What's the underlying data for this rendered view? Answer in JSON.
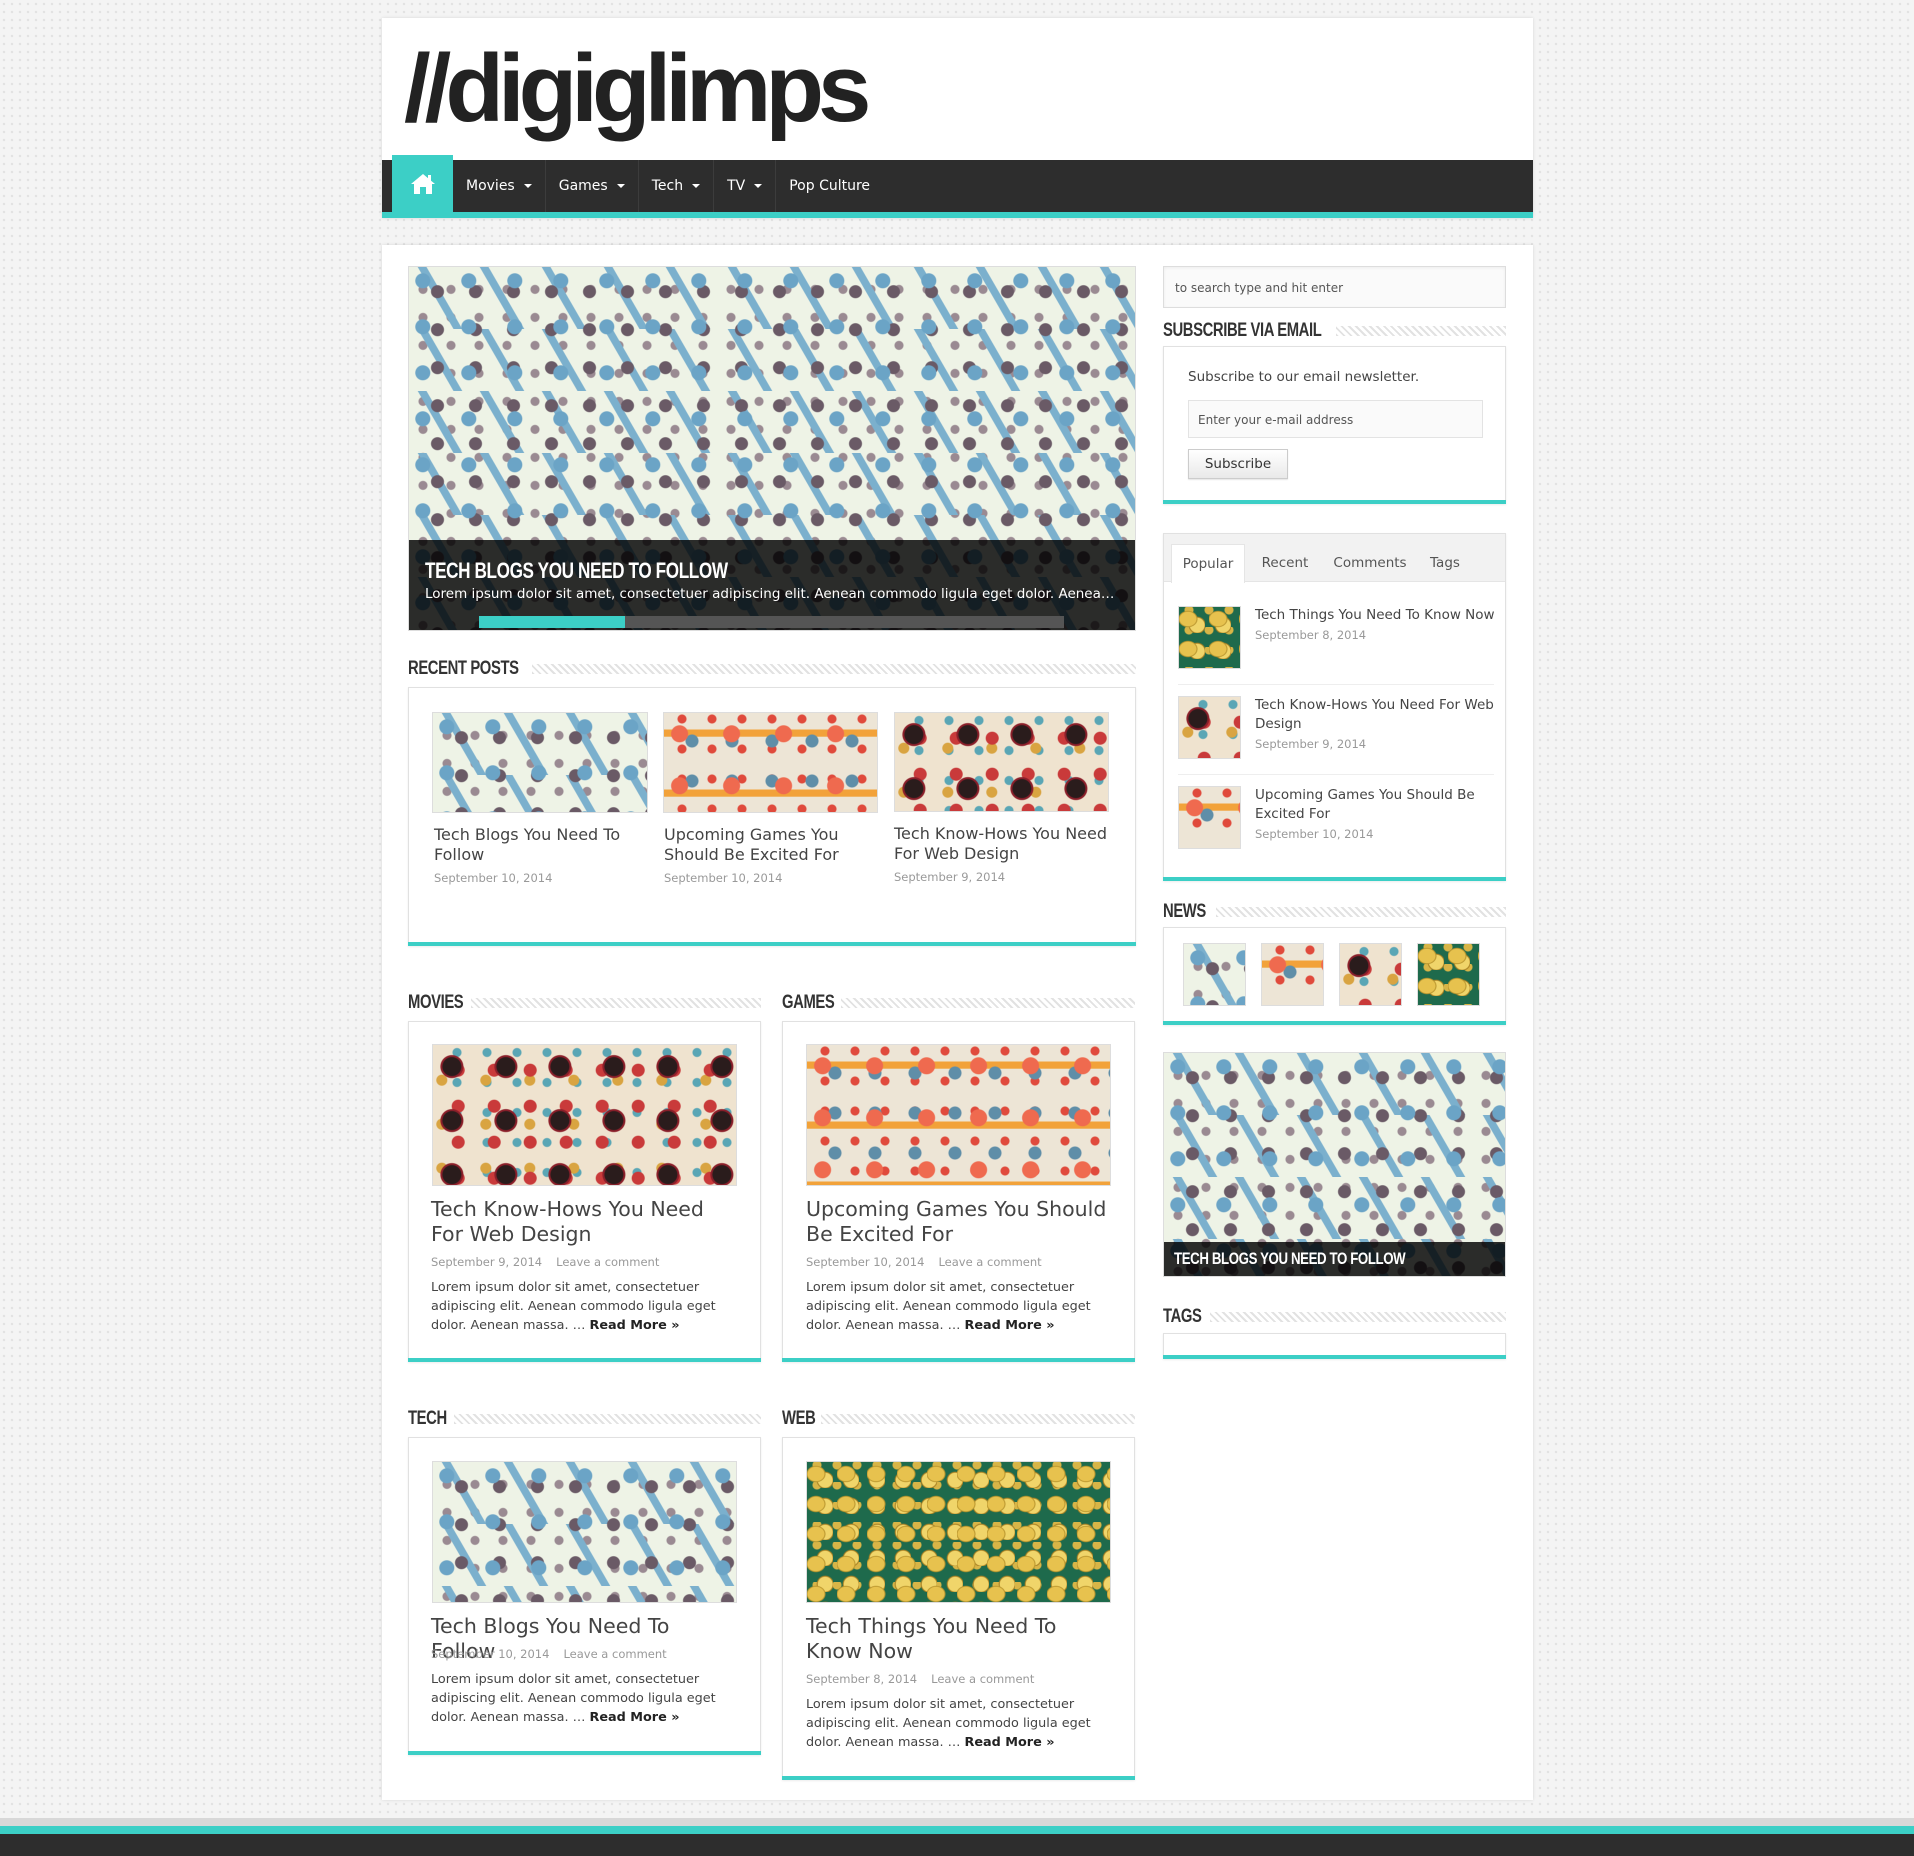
{
  "site": {
    "logo_text": "//digiglimps"
  },
  "nav": {
    "home_icon": "home-icon",
    "items": [
      {
        "label": "Movies",
        "dropdown": true
      },
      {
        "label": "Games",
        "dropdown": true
      },
      {
        "label": "Tech",
        "dropdown": true
      },
      {
        "label": "TV",
        "dropdown": true
      },
      {
        "label": "Pop Culture",
        "dropdown": false
      }
    ]
  },
  "slider": {
    "title": "TECH BLOGS YOU NEED TO FOLLOW",
    "excerpt": "Lorem ipsum dolor sit amet, consectetuer adipiscing elit. Aenean commodo ligula eget dolor. Aenean massa. Cum sociis natoque",
    "progress": 0.25
  },
  "recent_posts": {
    "heading": "RECENT POSTS",
    "items": [
      {
        "title": "Tech Blogs You Need To Follow",
        "date": "September 10, 2014"
      },
      {
        "title": "Upcoming Games You Should Be Excited For",
        "date": "September 10, 2014"
      },
      {
        "title": "Tech Know-Hows You Need For Web Design",
        "date": "September 9, 2014"
      }
    ]
  },
  "categories": [
    {
      "heading": "MOVIES",
      "title": "Tech Know-Hows You Need For Web Design",
      "date": "September 9, 2014",
      "comment": "Leave a comment",
      "excerpt": "Lorem ipsum dolor sit amet, consectetuer adipiscing elit. Aenean commodo ligula eget dolor. Aenean massa. …",
      "read_more": "Read More »"
    },
    {
      "heading": "GAMES",
      "title": "Upcoming Games You Should Be Excited For",
      "date": "September 10, 2014",
      "comment": "Leave a comment",
      "excerpt": "Lorem ipsum dolor sit amet, consectetuer adipiscing elit. Aenean commodo ligula eget dolor. Aenean massa. …",
      "read_more": "Read More »"
    },
    {
      "heading": "TECH",
      "title": "Tech Blogs You Need To Follow",
      "date": "September 10, 2014",
      "comment": "Leave a comment",
      "excerpt": "Lorem ipsum dolor sit amet, consectetuer adipiscing elit. Aenean commodo ligula eget dolor. Aenean massa. …",
      "read_more": "Read More »"
    },
    {
      "heading": "WEB",
      "title": "Tech Things You Need To Know Now",
      "date": "September 8, 2014",
      "comment": "Leave a comment",
      "excerpt": "Lorem ipsum dolor sit amet, consectetuer adipiscing elit. Aenean commodo ligula eget dolor. Aenean massa. …",
      "read_more": "Read More »"
    }
  ],
  "sidebar": {
    "search_placeholder": "to search type and hit enter",
    "subscribe": {
      "heading": "SUBSCRIBE VIA EMAIL",
      "text": "Subscribe to our email newsletter.",
      "input_placeholder": "Enter your e-mail address",
      "button": "Subscribe"
    },
    "tabs": [
      "Popular",
      "Recent",
      "Comments",
      "Tags"
    ],
    "popular": [
      {
        "title": "Tech Things You Need To Know Now",
        "date": "September 8, 2014"
      },
      {
        "title": "Tech Know-Hows You Need For Web Design",
        "date": "September 9, 2014"
      },
      {
        "title": "Upcoming Games You Should Be Excited For",
        "date": "September 10, 2014"
      }
    ],
    "news_heading": "NEWS",
    "slider_title": "TECH BLOGS YOU NEED TO FOLLOW",
    "tags_heading": "TAGS"
  },
  "colors": {
    "accent": "#3ccfc6",
    "nav_bg": "#2d2d2d"
  }
}
